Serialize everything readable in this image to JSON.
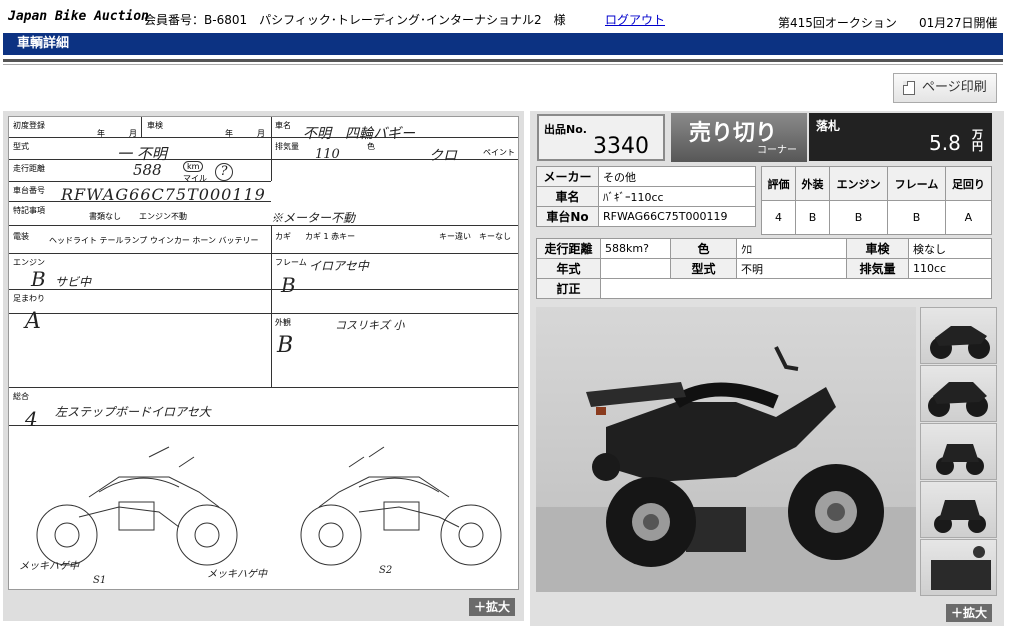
{
  "header": {
    "logo": "Japan Bike Auction",
    "member": "会員番号：B-6801　パシフィック･トレーディング･インターナショナル2　様",
    "logout": "ログアウト",
    "auction_round": "第415回オークション",
    "auction_date": "01月27日開催"
  },
  "title_bar": "車輌詳細",
  "print_button": "ページ印刷",
  "zoom_label": "＋拡大",
  "sheet": {
    "labels": {
      "first_reg": "初度登録",
      "year": "年",
      "month": "月",
      "inspection": "車検",
      "car_name": "車名",
      "model": "型式",
      "displacement": "排気量",
      "color": "色",
      "paint": "ペイント",
      "mileage": "走行距離",
      "frame_no": "車台番号",
      "notes": "特記事項",
      "doc_none": "書類なし",
      "engine_dead": "エンジン不動",
      "equipment": "電装",
      "equipment_items": "ヘッドライト テールランプ ウインカー ホーン バッテリー",
      "key": "カギ",
      "key_items": "カギ 1 赤キー",
      "key_right": "キー違い　キーなし",
      "engine": "エンジン",
      "frame": "フレーム",
      "suspension": "足まわり",
      "exterior": "外観",
      "overall": "総合",
      "km": "km",
      "mile": "マイル"
    },
    "hand": {
      "car_name": "不明　四輪バギー",
      "model": "一 不明",
      "displacement": "110",
      "color": "クロ",
      "mileage": "588",
      "frame_no": "RFWAG66C75T000119",
      "meter_note": "※メーター不動",
      "engine_grade": "B",
      "engine_note": "サビ中",
      "frame_grade": "B",
      "frame_note": "イロアセ中",
      "suspension_grade": "A",
      "exterior_grade": "B",
      "exterior_note": "コスリキズ 小",
      "overall_grade": "4",
      "overall_note": "左ステップボードイロアセ大",
      "diagram_left_a": "メッキハゲ中",
      "diagram_left_b": "S1",
      "diagram_right_a": "メッキハゲ中",
      "diagram_right_b": "S2"
    }
  },
  "lot": {
    "label": "出品No.",
    "number": "3340"
  },
  "sold": {
    "main": "売り切り",
    "sub": "コーナー"
  },
  "price": {
    "label": "落札",
    "value": "5.8",
    "unit": "万円"
  },
  "info1": {
    "maker_label": "メーカー",
    "maker": "その他",
    "name_label": "車名",
    "name": "ﾊﾞｷﾞｰ110cc",
    "frame_label": "車台No",
    "frame": "RFWAG66C75T000119"
  },
  "grades": {
    "headers": [
      "評価",
      "外装",
      "エンジン",
      "フレーム",
      "足回り"
    ],
    "values": [
      "4",
      "B",
      "B",
      "B",
      "A"
    ]
  },
  "info2": {
    "mileage_label": "走行距離",
    "mileage": "588km?",
    "color_label": "色",
    "color": "ｸﾛ",
    "inspection_label": "車検",
    "inspection": "検なし",
    "year_label": "年式",
    "year": "",
    "model_label": "型式",
    "model": "不明",
    "disp_label": "排気量",
    "disp": "110cc",
    "correction_label": "訂正",
    "correction": ""
  }
}
